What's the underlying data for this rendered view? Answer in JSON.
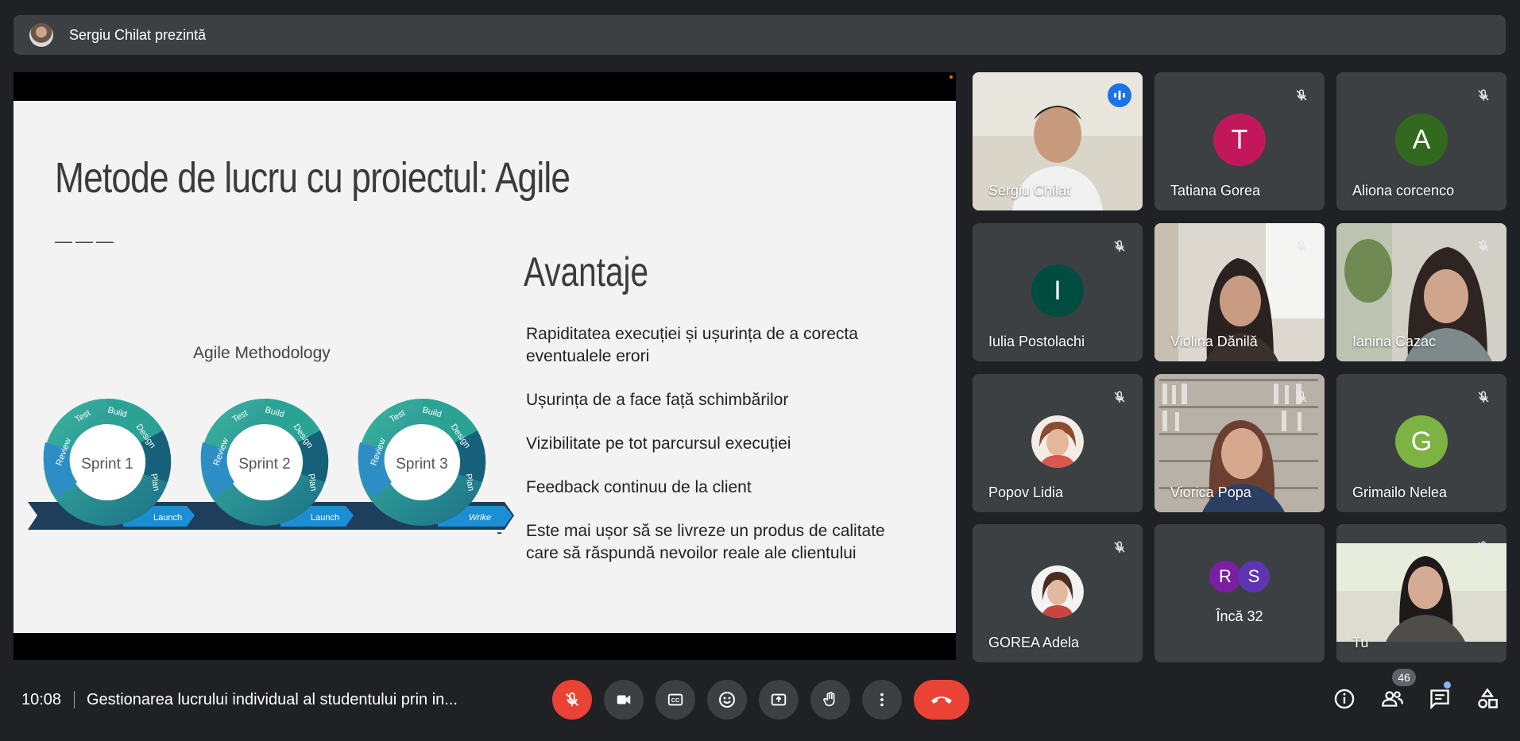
{
  "presenting_bar": {
    "text": "Sergiu Chilat prezintă"
  },
  "slide": {
    "title": "Metode de lucru cu proiectul: Agile",
    "dash": "———",
    "diagram_title": "Agile Methodology",
    "diagram_sprints": [
      "Sprint 1",
      "Sprint 2",
      "Sprint 3"
    ],
    "diagram_stages": [
      "Review",
      "Test",
      "Build",
      "Design",
      "Plan"
    ],
    "diagram_launch": [
      "Launch",
      "Launch"
    ],
    "diagram_logo": "Wrike",
    "subtitle": "Avantaje",
    "bullets": [
      "Rapiditatea execuției și ușurința de a corecta eventualele erori",
      "Ușurința de a face față schimbărilor",
      "Vizibilitate pe tot parcursul execuției",
      "Feedback continuu de la client",
      "Este mai ușor să se livreze un produs de calitate care să răspundă nevoilor reale ale clientului"
    ],
    "lone_dash": "-"
  },
  "participants": [
    {
      "name": "Sergiu Chilat",
      "type": "video",
      "speaking": true
    },
    {
      "name": "Tatiana Gorea",
      "type": "initial",
      "initial": "T",
      "color": "#c2185b"
    },
    {
      "name": "Aliona corcenco",
      "type": "initial",
      "initial": "A",
      "color": "#33691e"
    },
    {
      "name": "Iulia Postolachi",
      "type": "initial",
      "initial": "I",
      "color": "#004d40"
    },
    {
      "name": "Violina Dănilă",
      "type": "video"
    },
    {
      "name": "Ianina Cazac",
      "type": "video"
    },
    {
      "name": "Popov Lidia",
      "type": "photo"
    },
    {
      "name": "Viorica Popa",
      "type": "video"
    },
    {
      "name": "Grimailo Nelea",
      "type": "initial",
      "initial": "G",
      "color": "#7cb342"
    },
    {
      "name": "GOREA Adela",
      "type": "photo"
    },
    {
      "name": "Tu",
      "type": "video"
    }
  ],
  "more_tile": {
    "label": "Încă 32",
    "initials": [
      {
        "letter": "R",
        "color": "#7b1fa2"
      },
      {
        "letter": "S",
        "color": "#5e35b1"
      }
    ]
  },
  "bottom_bar": {
    "time": "10:08",
    "meeting_title": "Gestionarea lucrului individual al studentului prin in...",
    "controls": [
      "mic-off",
      "camera",
      "captions",
      "emoji",
      "present",
      "raise-hand",
      "more-options",
      "leave-call"
    ],
    "right_controls": [
      "meeting-details",
      "people",
      "chat",
      "activities"
    ],
    "participant_count": "46"
  }
}
